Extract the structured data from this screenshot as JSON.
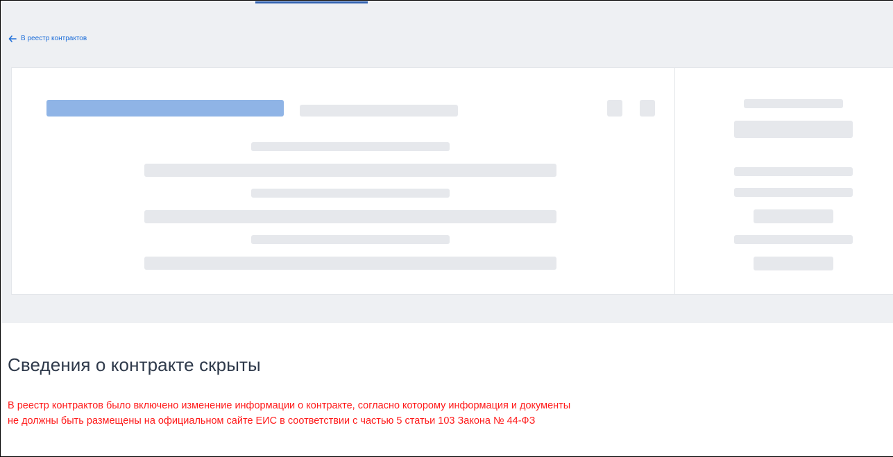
{
  "nav": {
    "back_link_label": "В реестр контрактов"
  },
  "status": {
    "heading": "Сведения о контракте скрыты",
    "notice": "В реестр контрактов было включено изменение информации о контракте, согласно которому информация и документы не должны быть размещены на официальном сайте ЕИС в соответствии с частью 5 статьи 103 Закона № 44-ФЗ"
  },
  "icons": {
    "back": "arrow-left-icon"
  },
  "colors": {
    "link": "#1f6fd9",
    "notice": "#ff1a1a",
    "heading": "#2f3a4b",
    "skeleton": "#e6e8ec",
    "skeleton_accent": "#8fb4e6",
    "page_background": "#eef0f3",
    "active_tab_indicator": "#0d47a1"
  }
}
